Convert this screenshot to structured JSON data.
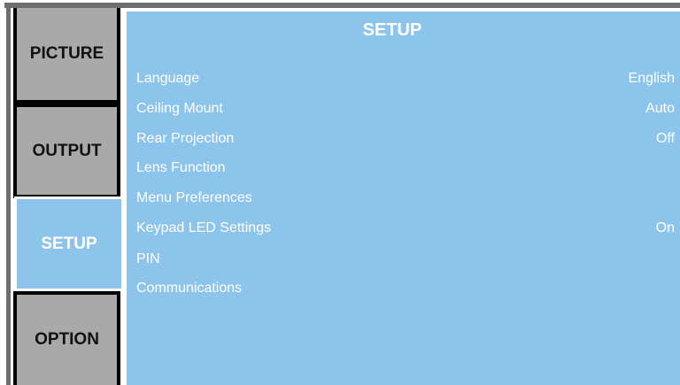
{
  "tabs": {
    "picture": "PICTURE",
    "output": "OUTPUT",
    "setup": "SETUP",
    "option": "OPTION"
  },
  "active_tab": "SETUP",
  "panel": {
    "title": "SETUP",
    "items": [
      {
        "label": "Language",
        "value": "English"
      },
      {
        "label": "Ceiling Mount",
        "value": "Auto"
      },
      {
        "label": "Rear Projection",
        "value": "Off"
      },
      {
        "label": "Lens Function",
        "value": ""
      },
      {
        "label": "Menu Preferences",
        "value": ""
      },
      {
        "label": "Keypad LED Settings",
        "value": "On"
      },
      {
        "label": "PIN",
        "value": ""
      },
      {
        "label": "Communications",
        "value": ""
      }
    ]
  },
  "colors": {
    "panel_background": "#8dc4eb",
    "inactive_tab": "#a9a9a9",
    "tab_border": "#000000",
    "text": "#ffffff"
  }
}
